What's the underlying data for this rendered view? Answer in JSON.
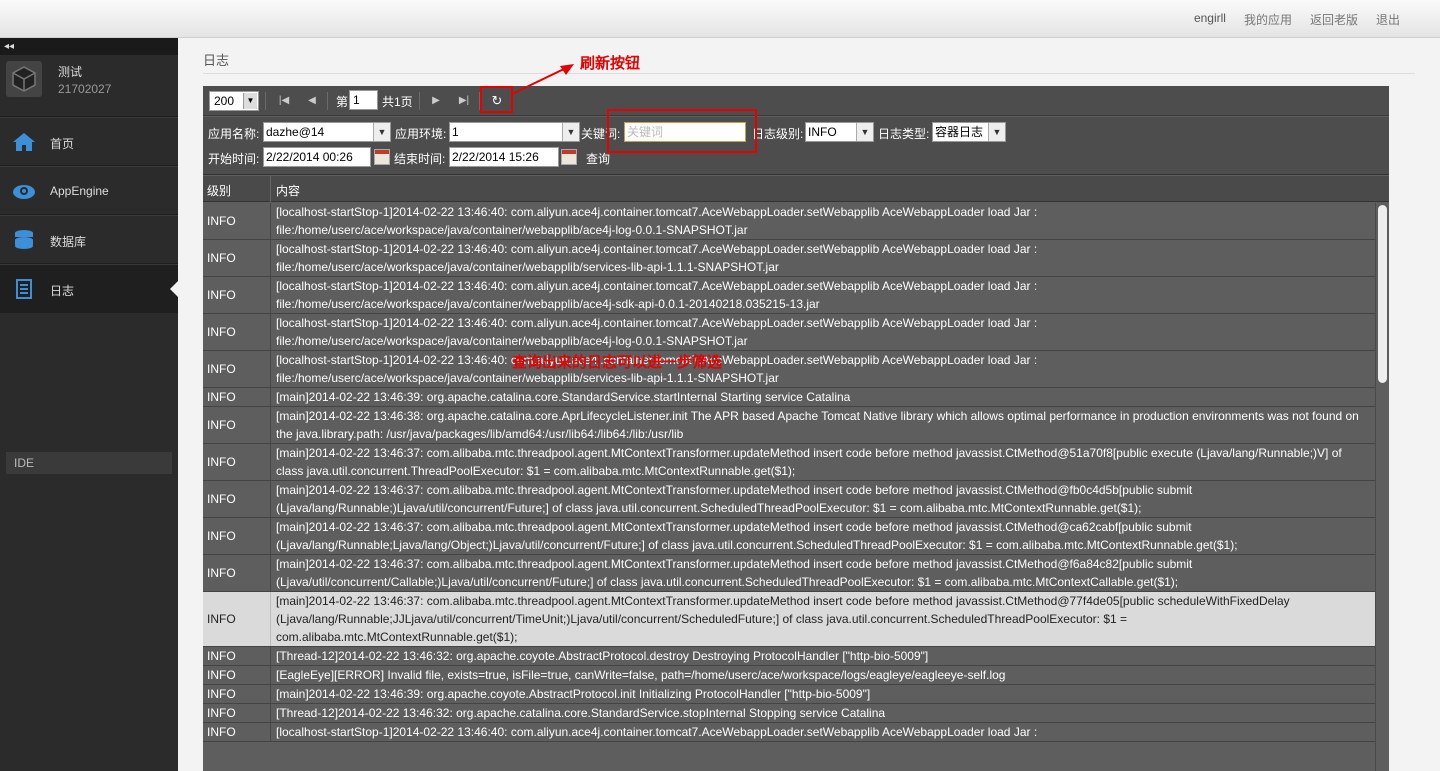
{
  "topnav": {
    "user": "engirll",
    "my_apps": "我的应用",
    "back_old": "返回老版",
    "logout": "退出"
  },
  "sidebar": {
    "collapse": "◂◂",
    "app_name": "测试",
    "app_id": "21702027",
    "items": [
      {
        "label": "首页",
        "icon": "home-icon"
      },
      {
        "label": "AppEngine",
        "icon": "cloud-gear-icon"
      },
      {
        "label": "数据库",
        "icon": "database-icon"
      },
      {
        "label": "日志",
        "icon": "log-document-icon"
      }
    ],
    "ide": "IDE"
  },
  "main": {
    "title": "日志"
  },
  "pager": {
    "page_size": "200",
    "page_prefix": "第",
    "page_num": "1",
    "page_total": "共1页"
  },
  "filters": {
    "app_name_label": "应用名称:",
    "app_name_value": "dazhe@14",
    "env_label": "应用环境:",
    "env_value": "1",
    "keyword_label": "关键词:",
    "keyword_placeholder": "关键词",
    "level_label": "日志级别:",
    "level_value": "INFO",
    "type_label": "日志类型:",
    "type_value": "容器日志",
    "start_label": "开始时间:",
    "start_value": "2/22/2014 00:26",
    "end_label": "结束时间:",
    "end_value": "2/22/2014 15:26",
    "query": "查询"
  },
  "table": {
    "headers": [
      "级别",
      "内容"
    ],
    "rows": [
      {
        "level": "INFO",
        "content": "[localhost-startStop-1]2014-02-22 13:46:40: com.aliyun.ace4j.container.tomcat7.AceWebappLoader.setWebapplib AceWebappLoader load Jar : file:/home/userc/ace/workspace/java/container/webapplib/ace4j-log-0.0.1-SNAPSHOT.jar"
      },
      {
        "level": "INFO",
        "content": "[localhost-startStop-1]2014-02-22 13:46:40: com.aliyun.ace4j.container.tomcat7.AceWebappLoader.setWebapplib AceWebappLoader load Jar : file:/home/userc/ace/workspace/java/container/webapplib/services-lib-api-1.1.1-SNAPSHOT.jar"
      },
      {
        "level": "INFO",
        "content": "[localhost-startStop-1]2014-02-22 13:46:40: com.aliyun.ace4j.container.tomcat7.AceWebappLoader.setWebapplib AceWebappLoader load Jar : file:/home/userc/ace/workspace/java/container/webapplib/ace4j-sdk-api-0.0.1-20140218.035215-13.jar"
      },
      {
        "level": "INFO",
        "content": "[localhost-startStop-1]2014-02-22 13:46:40: com.aliyun.ace4j.container.tomcat7.AceWebappLoader.setWebapplib AceWebappLoader load Jar : file:/home/userc/ace/workspace/java/container/webapplib/ace4j-log-0.0.1-SNAPSHOT.jar"
      },
      {
        "level": "INFO",
        "content": "[localhost-startStop-1]2014-02-22 13:46:40: com.aliyun.ace4j.container.tomcat7.AceWebappLoader.setWebapplib AceWebappLoader load Jar : file:/home/userc/ace/workspace/java/container/webapplib/services-lib-api-1.1.1-SNAPSHOT.jar"
      },
      {
        "level": "INFO",
        "content": "[main]2014-02-22 13:46:39: org.apache.catalina.core.StandardService.startInternal Starting service Catalina"
      },
      {
        "level": "INFO",
        "content": "[main]2014-02-22 13:46:38: org.apache.catalina.core.AprLifecycleListener.init The APR based Apache Tomcat Native library which allows optimal performance in production environments was not found on the java.library.path: /usr/java/packages/lib/amd64:/usr/lib64:/lib64:/lib:/usr/lib"
      },
      {
        "level": "INFO",
        "content": "[main]2014-02-22 13:46:37: com.alibaba.mtc.threadpool.agent.MtContextTransformer.updateMethod insert code before method javassist.CtMethod@51a70f8[public execute (Ljava/lang/Runnable;)V] of class java.util.concurrent.ThreadPoolExecutor: $1 = com.alibaba.mtc.MtContextRunnable.get($1);"
      },
      {
        "level": "INFO",
        "content": "[main]2014-02-22 13:46:37: com.alibaba.mtc.threadpool.agent.MtContextTransformer.updateMethod insert code before method javassist.CtMethod@fb0c4d5b[public submit (Ljava/lang/Runnable;)Ljava/util/concurrent/Future;] of class java.util.concurrent.ScheduledThreadPoolExecutor: $1 = com.alibaba.mtc.MtContextRunnable.get($1);"
      },
      {
        "level": "INFO",
        "content": "[main]2014-02-22 13:46:37: com.alibaba.mtc.threadpool.agent.MtContextTransformer.updateMethod insert code before method javassist.CtMethod@ca62cabf[public submit (Ljava/lang/Runnable;Ljava/lang/Object;)Ljava/util/concurrent/Future;] of class java.util.concurrent.ScheduledThreadPoolExecutor: $1 = com.alibaba.mtc.MtContextRunnable.get($1);"
      },
      {
        "level": "INFO",
        "content": "[main]2014-02-22 13:46:37: com.alibaba.mtc.threadpool.agent.MtContextTransformer.updateMethod insert code before method javassist.CtMethod@f6a84c82[public submit (Ljava/util/concurrent/Callable;)Ljava/util/concurrent/Future;] of class java.util.concurrent.ScheduledThreadPoolExecutor: $1 = com.alibaba.mtc.MtContextCallable.get($1);"
      },
      {
        "level": "INFO",
        "content": "[main]2014-02-22 13:46:37: com.alibaba.mtc.threadpool.agent.MtContextTransformer.updateMethod insert code before method javassist.CtMethod@77f4de05[public scheduleWithFixedDelay (Ljava/lang/Runnable;JJLjava/util/concurrent/TimeUnit;)Ljava/util/concurrent/ScheduledFuture;] of class java.util.concurrent.ScheduledThreadPoolExecutor: $1 = com.alibaba.mtc.MtContextRunnable.get($1);",
        "highlight": true
      },
      {
        "level": "INFO",
        "content": "[Thread-12]2014-02-22 13:46:32: org.apache.coyote.AbstractProtocol.destroy Destroying ProtocolHandler [\"http-bio-5009\"]"
      },
      {
        "level": "INFO",
        "content": "[EagleEye][ERROR] Invalid file, exists=true, isFile=true, canWrite=false, path=/home/userc/ace/workspace/logs/eagleye/eagleeye-self.log"
      },
      {
        "level": "INFO",
        "content": "[main]2014-02-22 13:46:39: org.apache.coyote.AbstractProtocol.init Initializing ProtocolHandler [\"http-bio-5009\"]"
      },
      {
        "level": "INFO",
        "content": "[Thread-12]2014-02-22 13:46:32: org.apache.catalina.core.StandardService.stopInternal Stopping service Catalina"
      },
      {
        "level": "INFO",
        "content": "[localhost-startStop-1]2014-02-22 13:46:40: com.aliyun.ace4j.container.tomcat7.AceWebappLoader.setWebapplib AceWebappLoader load Jar :"
      }
    ]
  },
  "annotations": {
    "refresh_label": "刷新按钮",
    "filter_note": "查询出来的日志可以进一步筛选",
    "color": "#e60000"
  }
}
